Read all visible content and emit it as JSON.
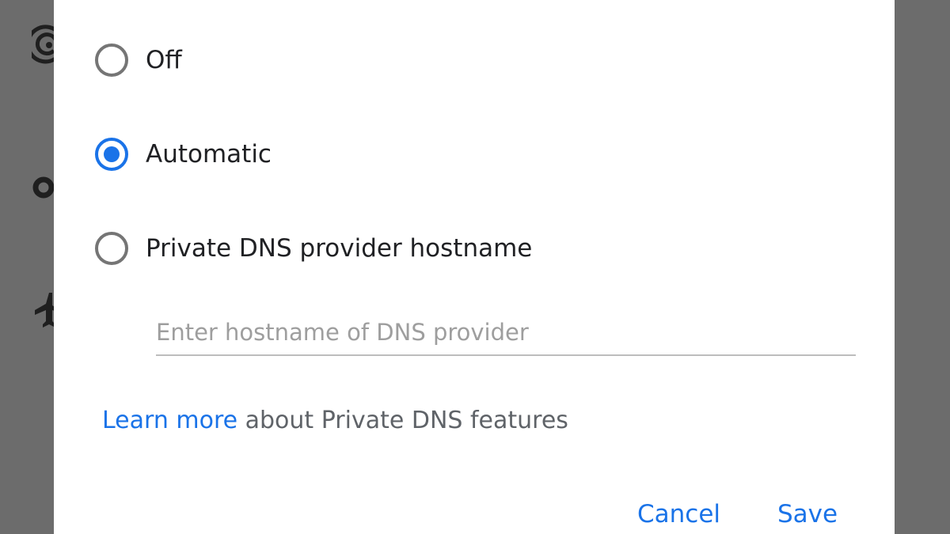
{
  "background_icons": [
    "hotspot-icon",
    "data-saver-icon",
    "airplane-mode-icon"
  ],
  "dialog": {
    "options": [
      {
        "label": "Off",
        "checked": false
      },
      {
        "label": "Automatic",
        "checked": true
      },
      {
        "label": "Private DNS provider hostname",
        "checked": false
      }
    ],
    "hostname_field": {
      "value": "",
      "placeholder": "Enter hostname of DNS provider"
    },
    "learn_more": {
      "link_text": "Learn more",
      "rest_text": " about Private DNS features"
    },
    "buttons": {
      "cancel": "Cancel",
      "save": "Save"
    }
  },
  "colors": {
    "accent": "#1a73e8",
    "scrim": "#6c6c6c",
    "radio_unchecked": "#757575"
  }
}
